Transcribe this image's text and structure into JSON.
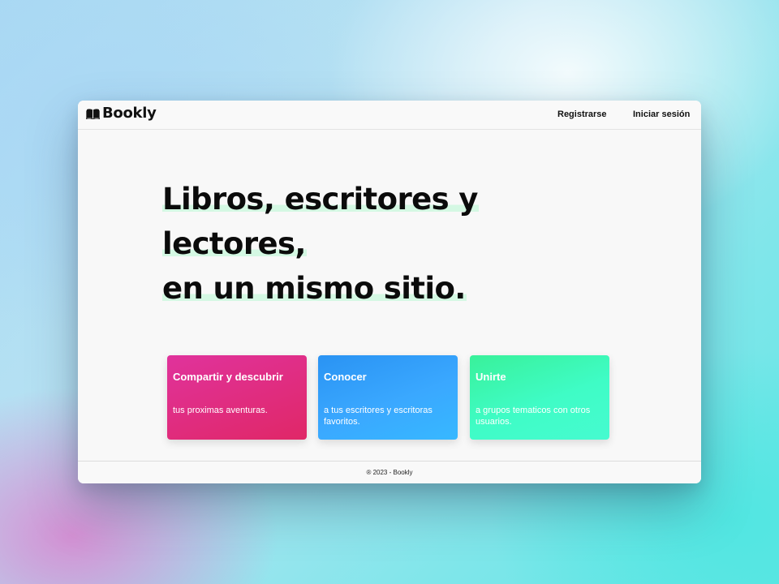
{
  "header": {
    "brand": "Bookly",
    "logo_icon": "open-book-icon",
    "nav": {
      "register": "Registrarse",
      "login": "Iniciar sesión"
    }
  },
  "hero": {
    "lines": [
      "Libros, escritores y",
      "lectores,",
      "en un mismo sitio."
    ],
    "highlight_color": "#d4f8e3"
  },
  "cards": [
    {
      "title": "Compartir y descubrir",
      "text": "tus proximas aventuras.",
      "gradient": [
        "#e0339c",
        "#e02767"
      ]
    },
    {
      "title": "Conocer",
      "text": "a tus escritores y escritoras favoritos.",
      "gradient": [
        "#2a93f3",
        "#37b8ff"
      ]
    },
    {
      "title": "Unirte",
      "text": "a grupos tematicos con otros usuarios.",
      "gradient": [
        "#39f19a",
        "#46fbd0"
      ]
    }
  ],
  "footer": {
    "text": "® 2023 - Bookly"
  }
}
